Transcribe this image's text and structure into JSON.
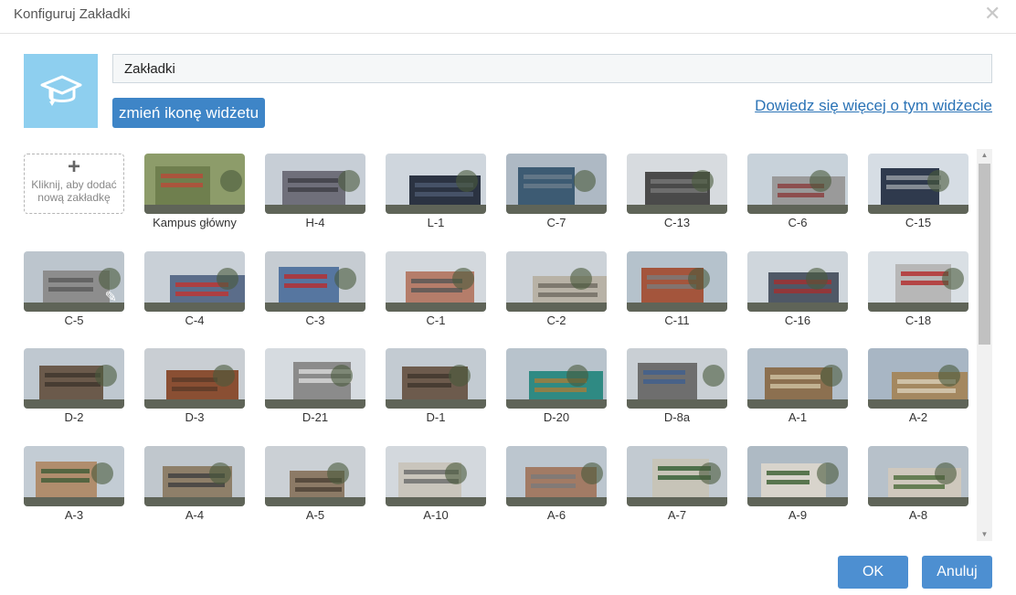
{
  "dialog": {
    "title": "Konfiguruj Zakładki",
    "name_value": "Zakładki",
    "change_icon_label": "zmień ikonę widżetu",
    "learn_more_label": "Dowiedz się więcej o tym widżecie",
    "ok_label": "OK",
    "cancel_label": "Anuluj",
    "widget_icon": "graduation-cap-icon",
    "accent_color": "#8ecfef",
    "button_color": "#4d8fd1"
  },
  "add_tile": {
    "plus": "+",
    "text_line1": "Kliknij, aby dodać",
    "text_line2": "nową zakładkę"
  },
  "tiles": [
    {
      "label": "Kampus główny",
      "sky": "#8d9c6a",
      "body": "#6f7f4e",
      "accent": "#b94b3a"
    },
    {
      "label": "H-4",
      "sky": "#c7ced6",
      "body": "#6f6f7a",
      "accent": "#3d3d45"
    },
    {
      "label": "L-1",
      "sky": "#cfd6dd",
      "body": "#2b3342",
      "accent": "#4d5a70"
    },
    {
      "label": "C-7",
      "sky": "#aeb9c4",
      "body": "#3d5b73",
      "accent": "#6b7d8c"
    },
    {
      "label": "C-13",
      "sky": "#d7dbdf",
      "body": "#4a4a4a",
      "accent": "#777"
    },
    {
      "label": "C-6",
      "sky": "#c8d2da",
      "body": "#9a9a9a",
      "accent": "#8a3b3b"
    },
    {
      "label": "C-15",
      "sky": "#d6dde4",
      "body": "#2f3a4d",
      "accent": "#9aa0a6"
    },
    {
      "label": "C-5",
      "sky": "#bcc5cd",
      "body": "#8d8d8d",
      "accent": "#5a5a5a",
      "editing": true
    },
    {
      "label": "C-4",
      "sky": "#c9d0d7",
      "body": "#5b6d8a",
      "accent": "#c0332f"
    },
    {
      "label": "C-3",
      "sky": "#c6ccd2",
      "body": "#5676a0",
      "accent": "#b92d2d"
    },
    {
      "label": "C-1",
      "sky": "#d3d8dd",
      "body": "#b57d6a",
      "accent": "#555"
    },
    {
      "label": "C-2",
      "sky": "#ccd2d8",
      "body": "#b8b2a6",
      "accent": "#6f6a62"
    },
    {
      "label": "C-11",
      "sky": "#b5c2cc",
      "body": "#a4553c",
      "accent": "#7b7b7b"
    },
    {
      "label": "C-16",
      "sky": "#cfd6dc",
      "body": "#4f5866",
      "accent": "#a23030"
    },
    {
      "label": "C-18",
      "sky": "#d9dfe4",
      "body": "#b7b7b7",
      "accent": "#b32828"
    },
    {
      "label": "D-2",
      "sky": "#bfc8d0",
      "body": "#6b5a4b",
      "accent": "#3f352c"
    },
    {
      "label": "D-3",
      "sky": "#c9ced3",
      "body": "#8a4f33",
      "accent": "#5a3928"
    },
    {
      "label": "D-21",
      "sky": "#d6dbe0",
      "body": "#8b8b8b",
      "accent": "#d9d9d9"
    },
    {
      "label": "D-1",
      "sky": "#c3cbd2",
      "body": "#6d5b4d",
      "accent": "#3e342c"
    },
    {
      "label": "D-20",
      "sky": "#b8c3cc",
      "body": "#2f8a83",
      "accent": "#a67c3a"
    },
    {
      "label": "D-8a",
      "sky": "#c9cfd4",
      "body": "#6e6e6e",
      "accent": "#3e5f8f"
    },
    {
      "label": "A-1",
      "sky": "#b3bfca",
      "body": "#8c7050",
      "accent": "#cfc3a3"
    },
    {
      "label": "A-2",
      "sky": "#a8b6c4",
      "body": "#a48860",
      "accent": "#d9cfb9"
    },
    {
      "label": "A-3",
      "sky": "#c3ccd4",
      "body": "#b08d6d",
      "accent": "#3f5b36"
    },
    {
      "label": "A-4",
      "sky": "#c0c7cd",
      "body": "#8e7f69",
      "accent": "#3f3f3f"
    },
    {
      "label": "A-5",
      "sky": "#cbd0d5",
      "body": "#8c7a66",
      "accent": "#4b4034"
    },
    {
      "label": "A-10",
      "sky": "#d3d8dd",
      "body": "#c9c5bc",
      "accent": "#6a6a6a"
    },
    {
      "label": "A-6",
      "sky": "#bcc6cf",
      "body": "#a27b65",
      "accent": "#7a7a7a"
    },
    {
      "label": "A-7",
      "sky": "#c2cad1",
      "body": "#c7c4b8",
      "accent": "#2f5b2f"
    },
    {
      "label": "A-9",
      "sky": "#aebac4",
      "body": "#d8d4cc",
      "accent": "#385d2e"
    },
    {
      "label": "A-8",
      "sky": "#b7c1ca",
      "body": "#cfc8bd",
      "accent": "#4b6b3a"
    }
  ]
}
